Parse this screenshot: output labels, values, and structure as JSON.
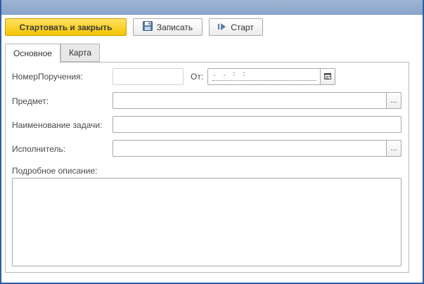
{
  "toolbar": {
    "start_close_label": "Стартовать и закрыть",
    "save_label": "Записать",
    "start_label": "Старт"
  },
  "tabs": [
    {
      "label": "Основное",
      "active": true
    },
    {
      "label": "Карта",
      "active": false
    }
  ],
  "form": {
    "order_number_label": "НомерПоручения:",
    "order_number_value": "",
    "from_label": "От:",
    "from_value_mask": ". .     :  :",
    "subject_label": "Предмет:",
    "subject_value": "",
    "task_name_label": "Наименование задачи:",
    "task_name_value": "",
    "executor_label": "Исполнитель:",
    "executor_value": "",
    "description_label": "Подробное описание:",
    "description_value": ""
  },
  "icons": {
    "save": "floppy-disk-icon",
    "start": "play-icon",
    "calendar": "calendar-icon",
    "ellipsis": "ellipsis-icon"
  },
  "colors": {
    "primary_button": "#f5c400",
    "window_frame": "#2b5ea8",
    "titlebar": "#8aa6cb"
  }
}
